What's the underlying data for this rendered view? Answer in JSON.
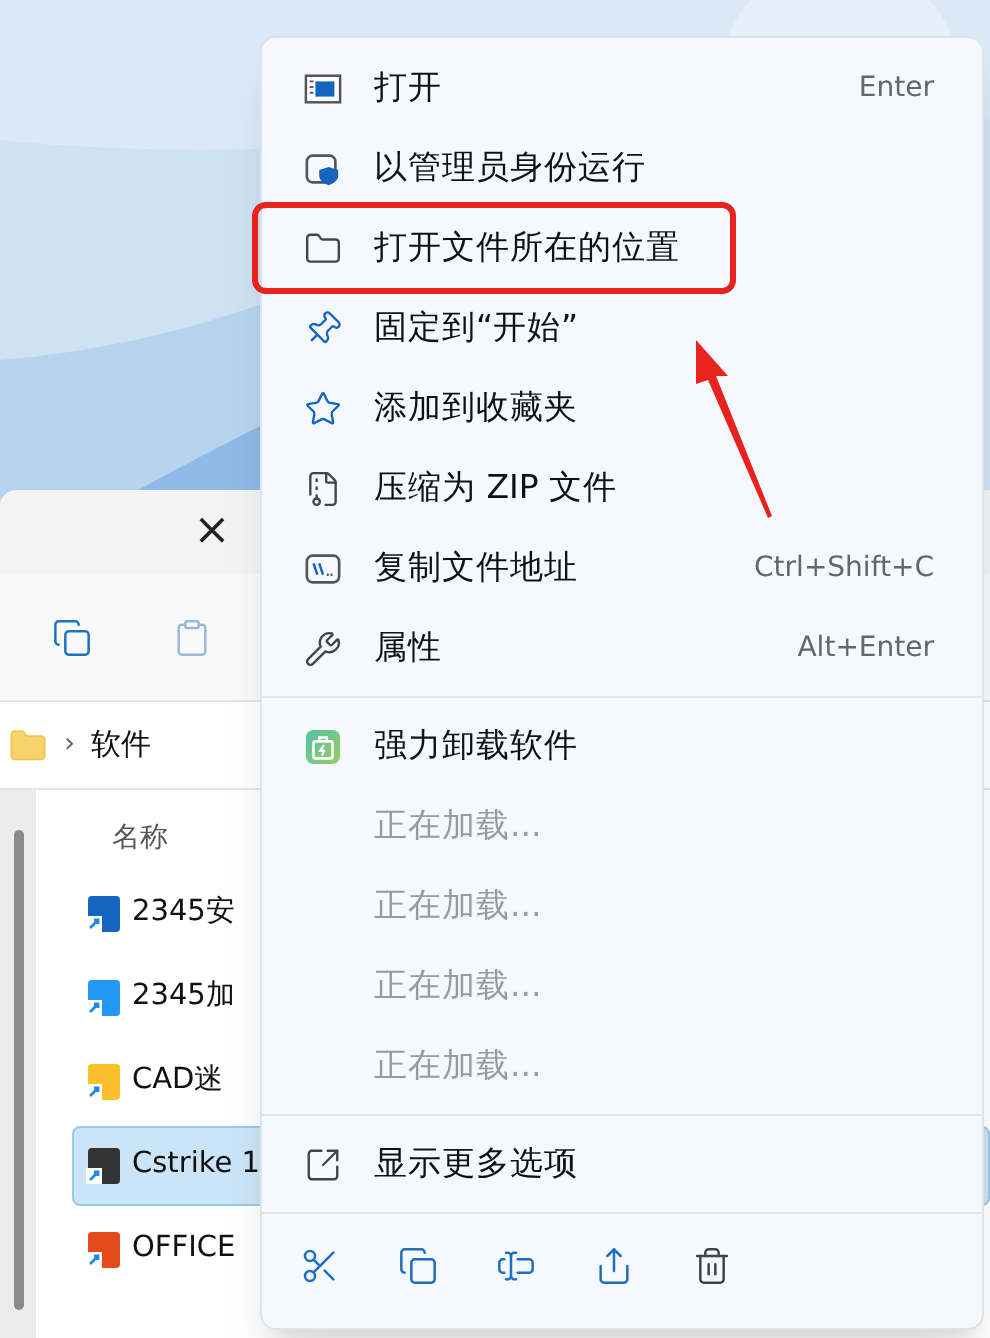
{
  "explorer": {
    "close": "×",
    "breadcrumb": {
      "separator": "›",
      "folder": "软件"
    },
    "column_header": "名称",
    "files": [
      {
        "name": "2345安",
        "selected": false
      },
      {
        "name": "2345加",
        "selected": false
      },
      {
        "name": "CAD迷",
        "selected": false
      },
      {
        "name": "Cstrike 1",
        "selected": true
      },
      {
        "name": "OFFICE",
        "selected": false
      }
    ]
  },
  "context_menu": {
    "groups": [
      [
        {
          "label": "打开",
          "shortcut": "Enter",
          "disabled": false,
          "annotated": false
        },
        {
          "label": "以管理员身份运行",
          "disabled": false,
          "annotated": false
        },
        {
          "label": "打开文件所在的位置",
          "disabled": false,
          "annotated": true
        },
        {
          "label": "固定到“开始”",
          "disabled": false,
          "annotated": false
        },
        {
          "label": "添加到收藏夹",
          "disabled": false,
          "annotated": false
        },
        {
          "label": "压缩为 ZIP 文件",
          "disabled": false,
          "annotated": false
        },
        {
          "label": "复制文件地址",
          "shortcut": "Ctrl+Shift+C",
          "disabled": false,
          "annotated": false
        },
        {
          "label": "属性",
          "shortcut": "Alt+Enter",
          "disabled": false,
          "annotated": false
        }
      ],
      [
        {
          "label": "强力卸载软件",
          "disabled": false,
          "annotated": false
        },
        {
          "label": "正在加载...",
          "disabled": true,
          "annotated": false
        },
        {
          "label": "正在加载...",
          "disabled": true,
          "annotated": false
        },
        {
          "label": "正在加载...",
          "disabled": true,
          "annotated": false
        },
        {
          "label": "正在加载...",
          "disabled": true,
          "annotated": false
        }
      ],
      [
        {
          "label": "显示更多选项",
          "disabled": false,
          "annotated": false
        }
      ]
    ]
  }
}
